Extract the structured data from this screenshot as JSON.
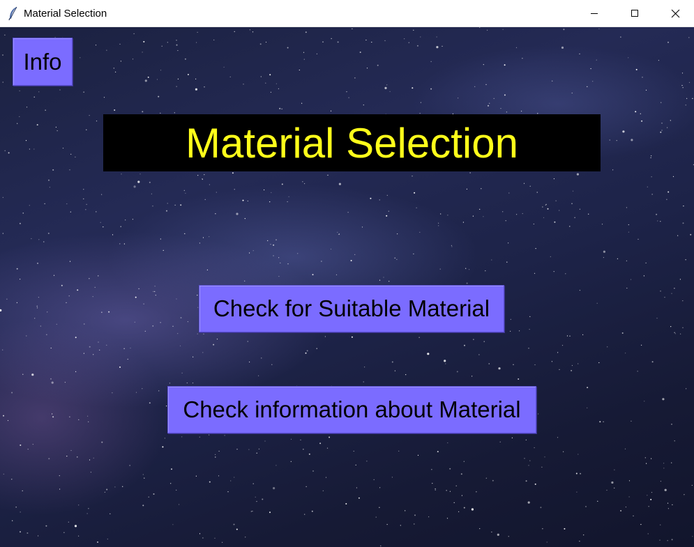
{
  "window": {
    "title": "Material Selection",
    "icon": "feather-icon"
  },
  "titlebar_controls": {
    "minimize_icon": "minimize-icon",
    "maximize_icon": "maximize-icon",
    "close_icon": "close-icon"
  },
  "main": {
    "info_button_label": "Info",
    "heading": "Material Selection",
    "suitable_button_label": "Check for Suitable Material",
    "info_about_button_label": "Check information about Material"
  },
  "colors": {
    "button_bg": "#7b6cff",
    "heading_bg": "#000000",
    "heading_text": "#ffff1a",
    "background": "starry-night"
  }
}
